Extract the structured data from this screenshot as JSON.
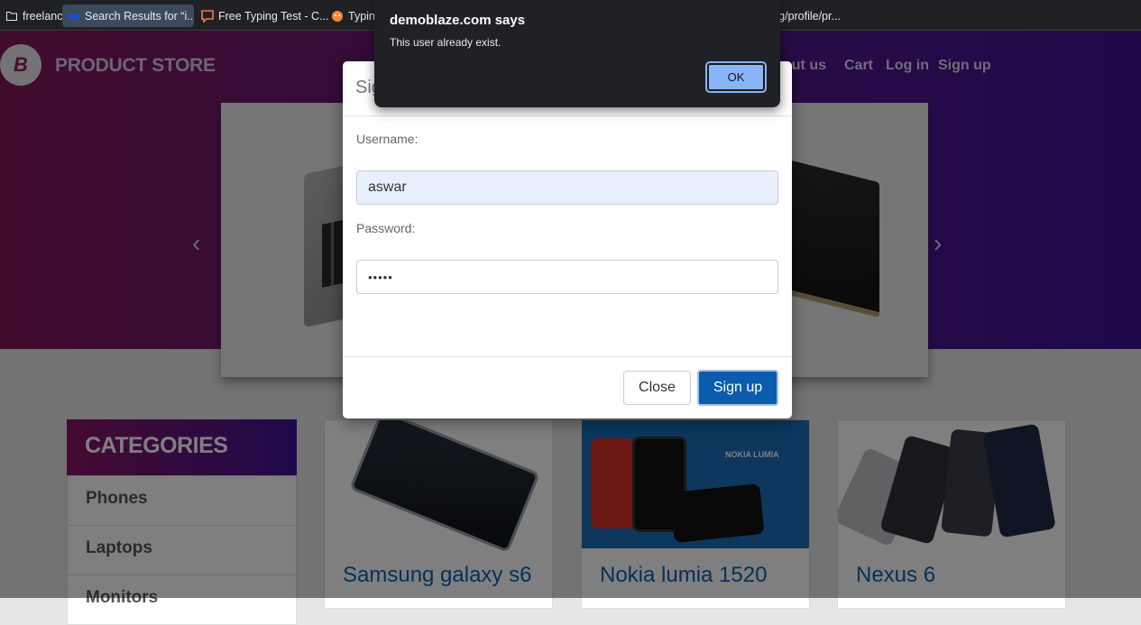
{
  "bookmarks": [
    {
      "label": "freelance",
      "icon": "folder-icon"
    },
    {
      "label": "Search Results for “i...",
      "icon": "search-favicon"
    },
    {
      "label": "Free Typing Test - C...",
      "icon": "chat-favicon"
    },
    {
      "label": "Typin",
      "icon": "typing-favicon"
    },
    {
      "label": "org/profile/pr...",
      "icon": ""
    }
  ],
  "site": {
    "brand": "PRODUCT STORE",
    "logo_letter": "B",
    "nav": {
      "about": "out us",
      "cart": "Cart",
      "login": "Log in",
      "signup": "Sign up"
    },
    "categories": {
      "title": "CATEGORIES",
      "items": [
        "Phones",
        "Laptops",
        "Monitors"
      ]
    },
    "products": [
      "Samsung galaxy s6",
      "Nokia lumia 1520",
      "Nexus 6"
    ],
    "nokia_banner": "NOKIA LUMIA",
    "colors": {
      "hero_start": "#821659",
      "hero_end": "#3d1196",
      "link": "#0a63b0"
    }
  },
  "modal": {
    "title": "Sig",
    "username_label": "Username:",
    "username_value": "aswar",
    "password_label": "Password:",
    "password_value": "•••••",
    "close_label": "Close",
    "signup_label": "Sign up"
  },
  "alert": {
    "title": "demoblaze.com says",
    "message": "This user already exist.",
    "ok_label": "OK"
  }
}
